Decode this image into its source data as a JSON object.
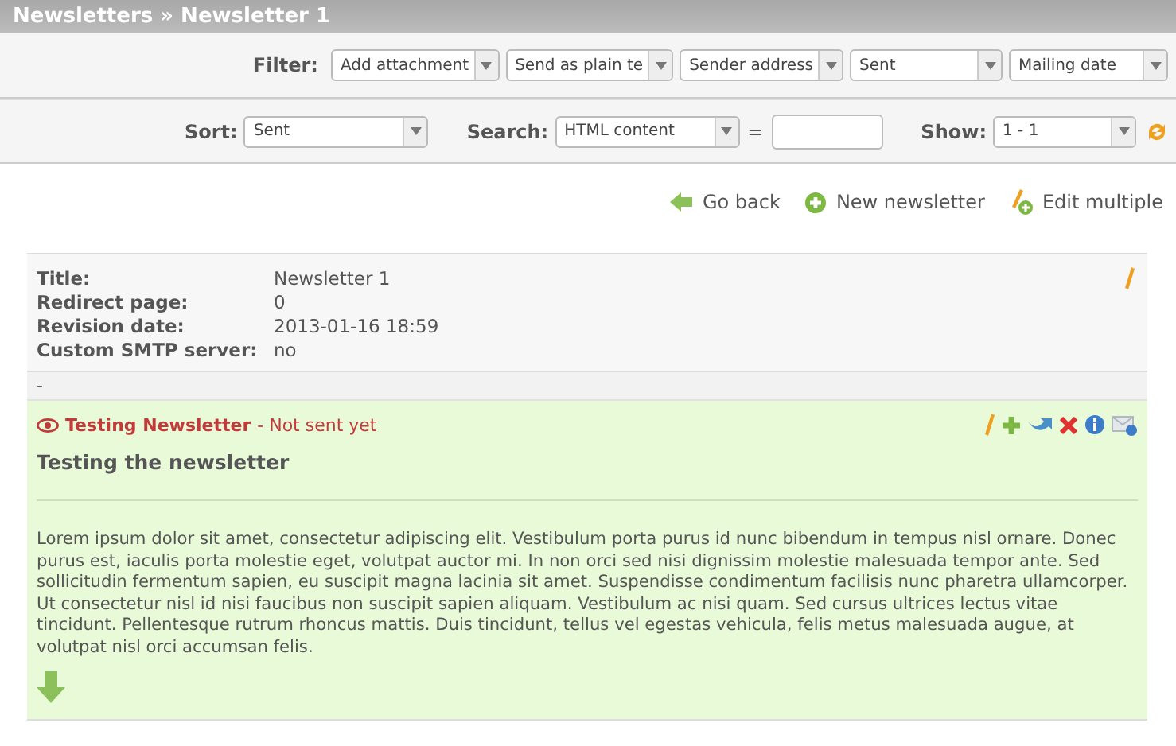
{
  "breadcrumb": "Newsletters » Newsletter 1",
  "filter": {
    "label": "Filter:",
    "selects": [
      "Add attachment",
      "Send as plain te",
      "Sender address",
      "Sent",
      "Mailing date"
    ]
  },
  "sort": {
    "label": "Sort:",
    "value": "Sent"
  },
  "search": {
    "label": "Search:",
    "field": "HTML content",
    "equals": "="
  },
  "show": {
    "label": "Show:",
    "value": "1 - 1"
  },
  "actions": [
    {
      "kind": "back",
      "label": "Go back"
    },
    {
      "kind": "new",
      "label": "New newsletter"
    },
    {
      "kind": "edit",
      "label": "Edit multiple"
    }
  ],
  "details": [
    {
      "label": "Title:",
      "value": "Newsletter 1"
    },
    {
      "label": "Redirect page:",
      "value": "0"
    },
    {
      "label": "Revision date:",
      "value": "2013-01-16 18:59"
    },
    {
      "label": "Custom SMTP server:",
      "value": "no"
    }
  ],
  "separator": "-",
  "message": {
    "name": "Testing Newsletter",
    "status": " - Not sent yet",
    "subject": "Testing the newsletter",
    "body": "Lorem ipsum dolor sit amet, consectetur adipiscing elit. Vestibulum porta purus id nunc bibendum in tempus nisl ornare. Donec purus est, iaculis porta molestie eget, volutpat auctor mi. In non orci sed nisi dignissim molestie malesuada tempor ante. Sed sollicitudin fermentum sapien, eu suscipit magna lacinia sit amet. Suspendisse condimentum facilisis nunc pharetra ullamcorper. Ut consectetur nisl id nisi faucibus non suscipit sapien aliquam. Vestibulum ac nisi quam. Sed cursus ultrices lectus vitae tincidunt. Pellentesque rutrum rhoncus mattis. Duis tincidunt, tellus vel egestas vehicula, felis metus malesuada augue, at volutpat nisl orci accumsan felis."
  }
}
